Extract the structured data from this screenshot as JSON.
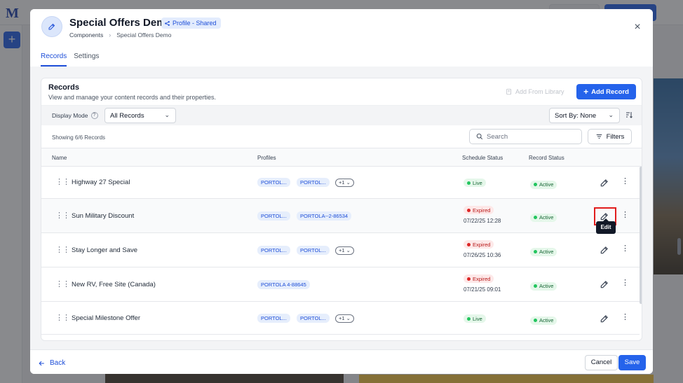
{
  "background": {
    "logo": "M",
    "add_label": "+"
  },
  "modal": {
    "title": "Special Offers Demo",
    "shared_badge": "Profile - Shared",
    "breadcrumb": [
      "Components",
      "Special Offers Demo"
    ],
    "breadcrumb_sep": "›",
    "close_glyph": "×",
    "tabs": [
      {
        "label": "Records",
        "active": true
      },
      {
        "label": "Settings",
        "active": false
      }
    ]
  },
  "records": {
    "title": "Records",
    "subtitle": "View and manage your content records and their properties.",
    "add_from_library": "Add From Library",
    "add_record": "Add Record",
    "display_mode_label": "Display Mode",
    "display_mode_value": "All Records",
    "sort_by": "Sort By: None",
    "showing": "Showing 6/6 Records",
    "search_placeholder": "Search",
    "filters": "Filters",
    "columns": {
      "name": "Name",
      "profiles": "Profiles",
      "schedule": "Schedule Status",
      "record": "Record Status"
    },
    "rows": [
      {
        "name": "Highway 27 Special",
        "profiles": [
          "PORTOL...",
          "PORTOL..."
        ],
        "more": "+1",
        "schedule": "Live",
        "date": "",
        "status": "Active"
      },
      {
        "name": "Sun Military Discount",
        "profiles": [
          "PORTOL...",
          "PORTOLA--2-86534"
        ],
        "more": "",
        "schedule": "Expired",
        "date": "07/22/25 12:28",
        "status": "Active"
      },
      {
        "name": "Stay Longer and Save",
        "profiles": [
          "PORTOL...",
          "PORTOL..."
        ],
        "more": "+1",
        "schedule": "Expired",
        "date": "07/26/25 10:36",
        "status": "Active"
      },
      {
        "name": "New RV, Free Site (Canada)",
        "profiles": [
          "PORTOLA 4-88645"
        ],
        "more": "",
        "schedule": "Expired",
        "date": "07/21/25 09:01",
        "status": "Active"
      },
      {
        "name": "Special Milestone Offer",
        "profiles": [
          "PORTOL...",
          "PORTOL..."
        ],
        "more": "+1",
        "schedule": "Live",
        "date": "",
        "status": "Active"
      }
    ],
    "tooltip": "Edit"
  },
  "footer": {
    "back": "Back",
    "cancel": "Cancel",
    "save": "Save"
  },
  "colors": {
    "accent": "#2563eb",
    "live": "#22c55e",
    "expired": "#dc2626",
    "highlight": "#e11d1d"
  }
}
